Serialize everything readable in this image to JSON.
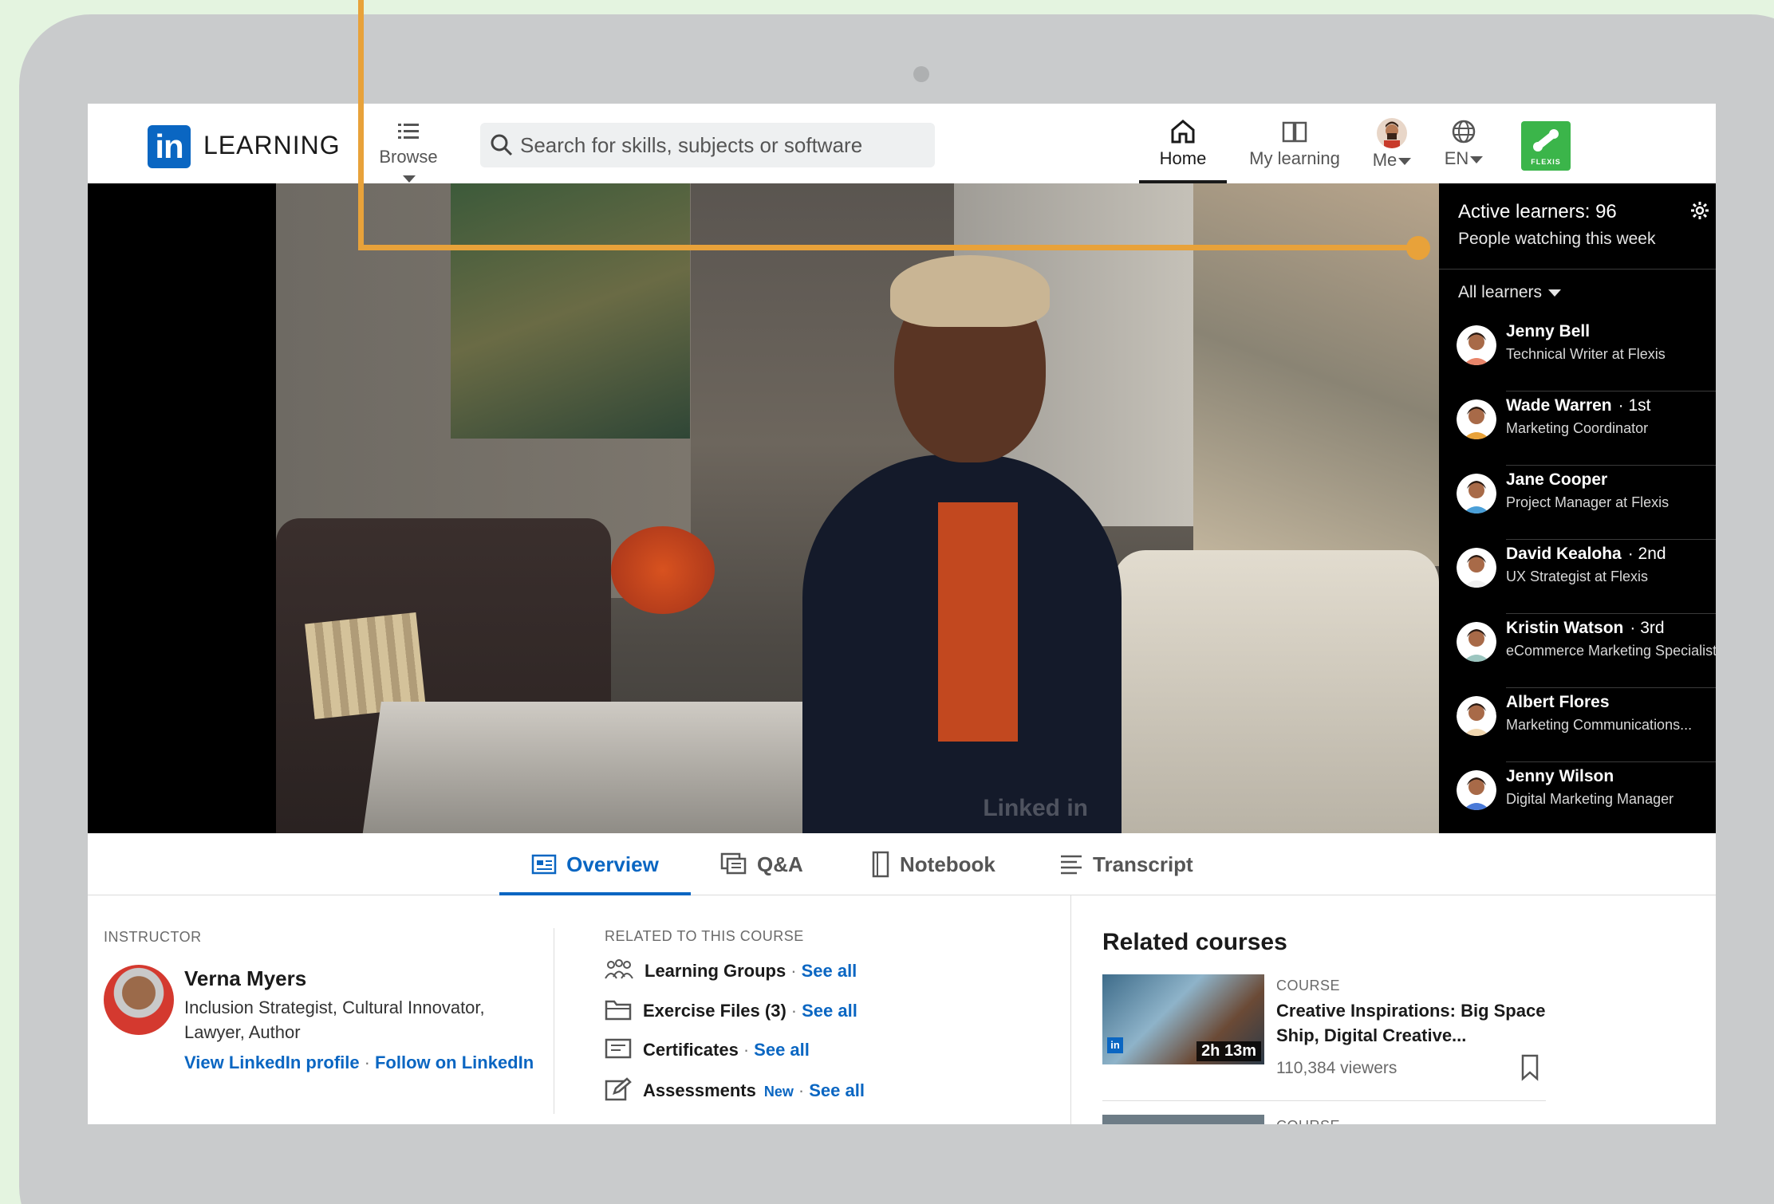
{
  "nav": {
    "logo_mark": "in",
    "logo_text": "LEARNING",
    "browse_label": "Browse",
    "search_placeholder": "Search for skills, subjects or software",
    "home_label": "Home",
    "my_learning_label": "My learning",
    "me_label": "Me",
    "lang_label": "EN",
    "org_badge": "FLEXIS"
  },
  "video": {
    "watermark": "Linked in"
  },
  "learners_panel": {
    "title": "Active learners: 96",
    "subtitle": "People watching this week",
    "filter_label": "All learners",
    "learners": [
      {
        "name": "Jenny Bell",
        "degree": "",
        "title": "Technical Writer at Flexis",
        "color": "#e8856a"
      },
      {
        "name": "Wade Warren",
        "degree": "· 1st",
        "title": "Marketing Coordinator",
        "color": "#e8a23a"
      },
      {
        "name": "Jane Cooper",
        "degree": "",
        "title": "Project Manager at Flexis",
        "color": "#4a9fd8"
      },
      {
        "name": "David Kealoha",
        "degree": "· 2nd",
        "title": "UX Strategist at Flexis",
        "color": "#f0f0f0"
      },
      {
        "name": "Kristin Watson",
        "degree": "· 3rd",
        "title": "eCommerce Marketing Specialist",
        "color": "#9cc6c0"
      },
      {
        "name": "Albert Flores",
        "degree": "",
        "title": "Marketing Communications...",
        "color": "#f1d7b0"
      },
      {
        "name": "Jenny Wilson",
        "degree": "",
        "title": "Digital Marketing Manager",
        "color": "#4a7ad8"
      }
    ]
  },
  "tabs": {
    "overview": "Overview",
    "qa": "Q&A",
    "notebook": "Notebook",
    "transcript": "Transcript"
  },
  "instructor": {
    "label": "INSTRUCTOR",
    "name": "Verna Myers",
    "title": "Inclusion Strategist, Cultural Innovator, Lawyer, Author",
    "view_profile": "View LinkedIn profile",
    "follow": "Follow on LinkedIn"
  },
  "related": {
    "label": "RELATED TO THIS COURSE",
    "see_all": "See all",
    "learning_groups": "Learning Groups",
    "exercise_files": "Exercise Files (3)",
    "certificates": "Certificates",
    "assessments": "Assessments",
    "new_badge": "New"
  },
  "related_courses": {
    "title": "Related courses",
    "items": [
      {
        "type": "COURSE",
        "name": "Creative Inspirations: Big Space Ship, Digital Creative...",
        "viewers": "110,384 viewers",
        "duration": "2h 13m"
      },
      {
        "type": "COURSE"
      }
    ]
  },
  "colors": {
    "brand_blue": "#0a66c2",
    "annotation_orange": "#e8a23a",
    "flexis_green": "#3bb54a"
  }
}
